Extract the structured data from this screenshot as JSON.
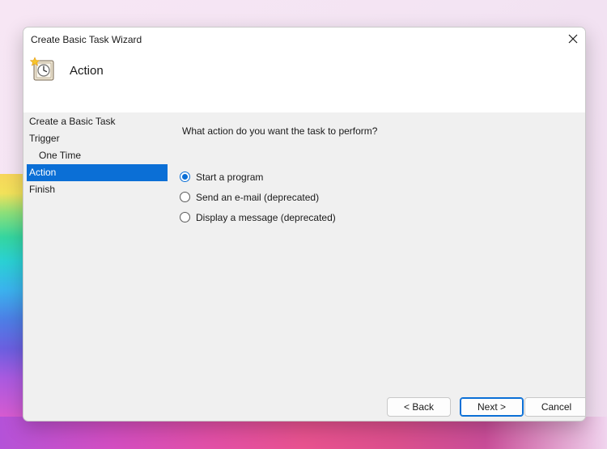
{
  "window": {
    "title": "Create Basic Task Wizard",
    "heading": "Action",
    "icon": "task-scheduler-clock-icon"
  },
  "steps": [
    {
      "label": "Create a Basic Task",
      "active": false,
      "sub": false
    },
    {
      "label": "Trigger",
      "active": false,
      "sub": false
    },
    {
      "label": "One Time",
      "active": false,
      "sub": true
    },
    {
      "label": "Action",
      "active": true,
      "sub": false
    },
    {
      "label": "Finish",
      "active": false,
      "sub": false
    }
  ],
  "main": {
    "question": "What action do you want the task to perform?",
    "options": [
      {
        "label": "Start a program",
        "checked": true
      },
      {
        "label": "Send an e-mail (deprecated)",
        "checked": false
      },
      {
        "label": "Display a message (deprecated)",
        "checked": false
      }
    ]
  },
  "buttons": {
    "back": "< Back",
    "next": "Next >",
    "cancel": "Cancel"
  },
  "colors": {
    "accent": "#0b6fd6",
    "panel": "#f0f0f0",
    "header": "#ffffff"
  }
}
